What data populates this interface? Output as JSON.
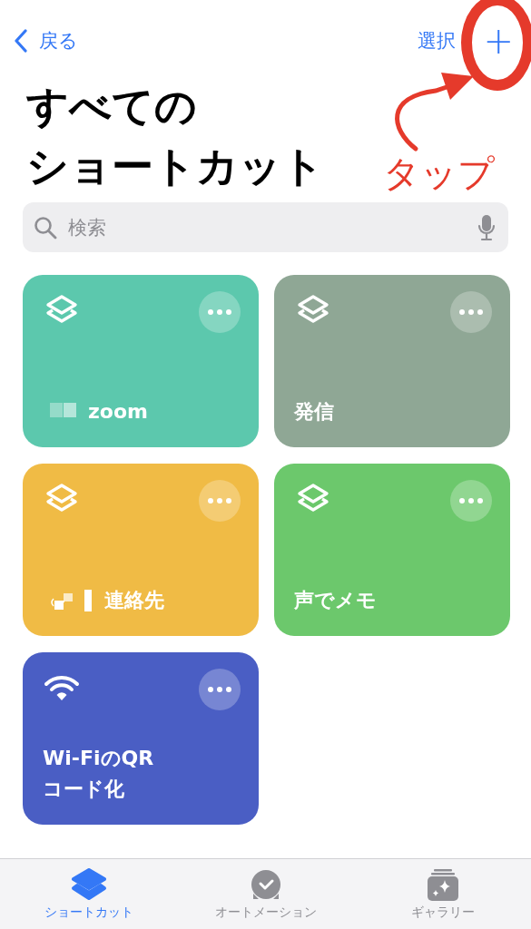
{
  "nav": {
    "back": "戻る",
    "select": "選択",
    "add": "+"
  },
  "title_lines": [
    "すべての",
    "ショートカット"
  ],
  "annotation": {
    "text": "タップ"
  },
  "search": {
    "placeholder": "検索"
  },
  "shortcuts": [
    {
      "kind": "layers",
      "title_lines": [
        "zoom"
      ],
      "color": "#5cc8ad"
    },
    {
      "kind": "layers",
      "title_lines": [
        "発信"
      ],
      "color": "#8fa795"
    },
    {
      "kind": "layers",
      "title_lines": [
        "連絡先"
      ],
      "color": "#f0bb45"
    },
    {
      "kind": "layers",
      "title_lines": [
        "声でメモ"
      ],
      "color": "#6cc86c"
    },
    {
      "kind": "wifi",
      "title_lines": [
        "Wi-FiのQR",
        "コード化"
      ],
      "color": "#4a5ec4"
    }
  ],
  "tabs": [
    {
      "kind": "layers",
      "label": "ショートカット",
      "selected": true
    },
    {
      "kind": "clock",
      "label": "オートメーション",
      "selected": false
    },
    {
      "kind": "gallery",
      "label": "ギャラリー",
      "selected": false
    }
  ]
}
